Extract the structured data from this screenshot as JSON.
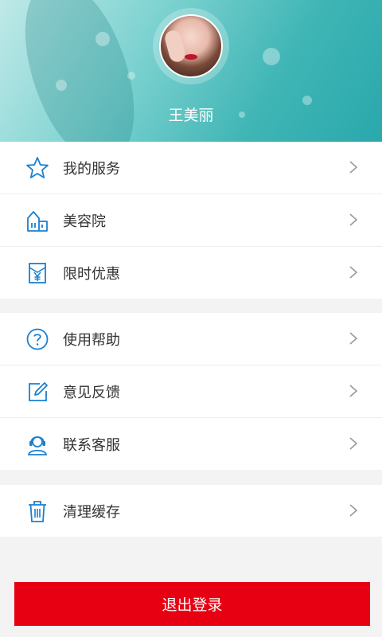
{
  "profile": {
    "name": "王美丽"
  },
  "menu_group_1": [
    {
      "label": "我的服务",
      "icon": "star-icon"
    },
    {
      "label": "美容院",
      "icon": "building-icon"
    },
    {
      "label": "限时优惠",
      "icon": "yen-tag-icon"
    }
  ],
  "menu_group_2": [
    {
      "label": "使用帮助",
      "icon": "help-icon"
    },
    {
      "label": "意见反馈",
      "icon": "edit-icon"
    },
    {
      "label": "联系客服",
      "icon": "headset-icon"
    }
  ],
  "menu_group_3": [
    {
      "label": "清理缓存",
      "icon": "trash-icon"
    }
  ],
  "logout": {
    "label": "退出登录"
  },
  "colors": {
    "accent": "#1a80d0",
    "logout": "#e60012"
  }
}
